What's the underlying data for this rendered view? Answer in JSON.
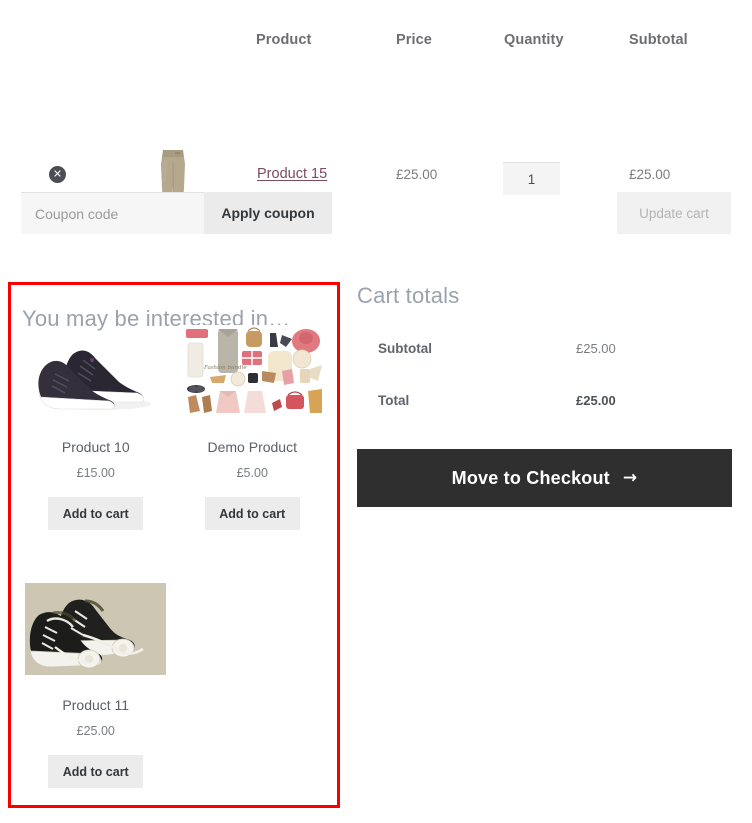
{
  "cart": {
    "headers": {
      "product": "Product",
      "price": "Price",
      "quantity": "Quantity",
      "subtotal": "Subtotal"
    },
    "item": {
      "remove_glyph": "✕",
      "name": "Product 15",
      "price": "£25.00",
      "quantity": "1",
      "subtotal": "£25.00"
    },
    "coupon": {
      "placeholder": "Coupon code",
      "value": "",
      "apply_label": "Apply coupon"
    },
    "update_label": "Update cart"
  },
  "upsell": {
    "title": "You may be interested in…",
    "highlight_color": "#f80000",
    "products": [
      {
        "name": "Product 10",
        "price": "£15.00",
        "button": "Add to cart"
      },
      {
        "name": "Demo Product",
        "price": "£5.00",
        "button": "Add to cart"
      },
      {
        "name": "Product 11",
        "price": "£25.00",
        "button": "Add to cart"
      }
    ]
  },
  "totals": {
    "title": "Cart totals",
    "rows": [
      {
        "label": "Subtotal",
        "value": "£25.00"
      },
      {
        "label": "Total",
        "value": "£25.00"
      }
    ],
    "checkout_label": "Move to Checkout",
    "checkout_arrow": "→"
  }
}
